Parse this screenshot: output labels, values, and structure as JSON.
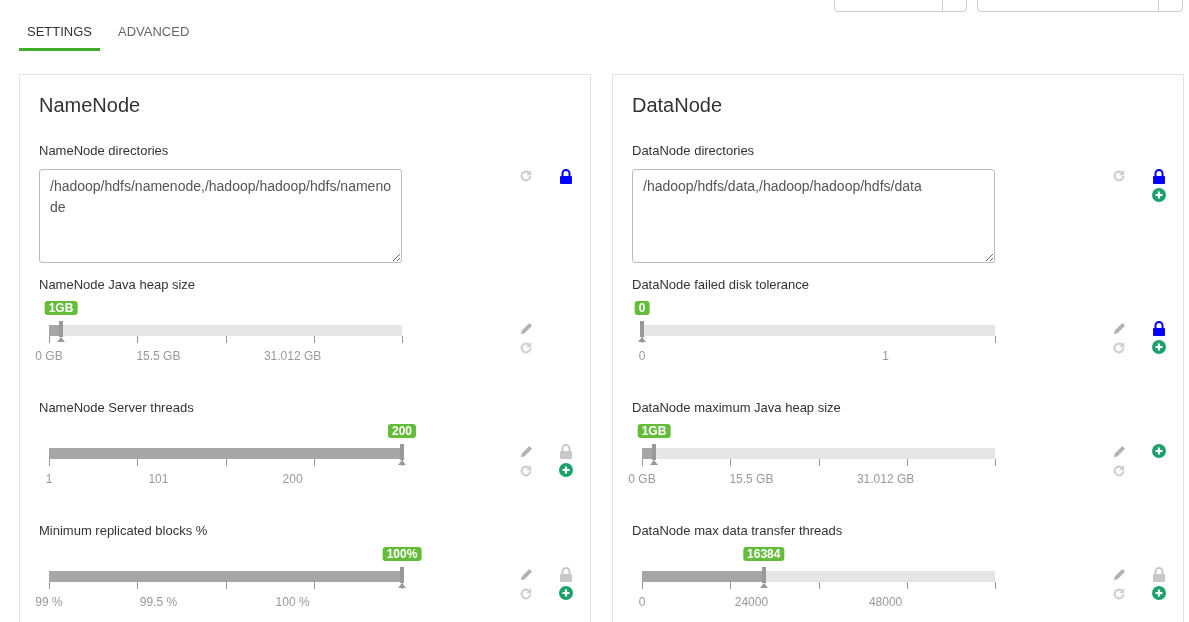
{
  "top_controls": [
    {
      "kind": "split"
    },
    {
      "kind": "filter"
    }
  ],
  "tabs": [
    {
      "label": "SETTINGS",
      "selected": true
    },
    {
      "label": "ADVANCED",
      "selected": false
    }
  ],
  "panels": [
    {
      "title": "NameNode",
      "properties": [
        {
          "kind": "textarea",
          "label": "NameNode directories",
          "value": "/hadoop/hdfs/namenode,/hadoop/hadoop/hdfs/namenode",
          "icons": [
            {
              "kind": "undo"
            },
            {
              "kind": "lock",
              "on": true
            }
          ]
        },
        {
          "kind": "slider",
          "label": "NameNode Java heap size",
          "badge": "1GB",
          "level": 0.034,
          "marks": [
            "0 GB",
            "15.5 GB",
            "31.012 GB"
          ],
          "icons": [
            {
              "kind": "edit"
            },
            {
              "kind": "undo"
            }
          ]
        },
        {
          "kind": "slider",
          "label": "NameNode Server threads",
          "badge": "200",
          "level": 1,
          "marks": [
            "1",
            "101",
            "200"
          ],
          "icons": [
            {
              "kind": "edit"
            },
            {
              "kind": "undo"
            },
            {
              "kind": "lock",
              "on": false
            },
            {
              "kind": "add"
            }
          ]
        },
        {
          "kind": "slider",
          "label": "Minimum replicated blocks %",
          "badge": "100%",
          "level": 1,
          "marks": [
            "99 %",
            "99.5 %",
            "100 %"
          ],
          "icons": [
            {
              "kind": "edit"
            },
            {
              "kind": "undo"
            },
            {
              "kind": "lock",
              "on": false
            },
            {
              "kind": "add"
            }
          ]
        }
      ]
    },
    {
      "title": "DataNode",
      "properties": [
        {
          "kind": "textarea",
          "label": "DataNode directories",
          "value": "/hadoop/hdfs/data,/hadoop/hadoop/hdfs/data",
          "icons": [
            {
              "kind": "undo"
            },
            {
              "kind": "lock",
              "on": true
            },
            {
              "kind": "add"
            }
          ]
        },
        {
          "kind": "slider",
          "label": "DataNode failed disk tolerance",
          "badge": "0",
          "level": 0,
          "marks": [
            "0",
            "1"
          ],
          "icons": [
            {
              "kind": "edit"
            },
            {
              "kind": "undo"
            },
            {
              "kind": "lock",
              "on": true
            },
            {
              "kind": "add"
            }
          ]
        },
        {
          "kind": "slider",
          "label": "DataNode maximum Java heap size",
          "badge": "1GB",
          "level": 0.034,
          "marks": [
            "0 GB",
            "15.5 GB",
            "31.012 GB"
          ],
          "icons": [
            {
              "kind": "edit"
            },
            {
              "kind": "undo"
            },
            {
              "kind": "add"
            }
          ]
        },
        {
          "kind": "slider",
          "label": "DataNode max data transfer threads",
          "badge": "16384",
          "level": 0.345,
          "marks": [
            "0",
            "24000",
            "48000"
          ],
          "icons": [
            {
              "kind": "edit"
            },
            {
              "kind": "undo"
            },
            {
              "kind": "lock",
              "on": false
            },
            {
              "kind": "add"
            }
          ]
        }
      ]
    }
  ]
}
